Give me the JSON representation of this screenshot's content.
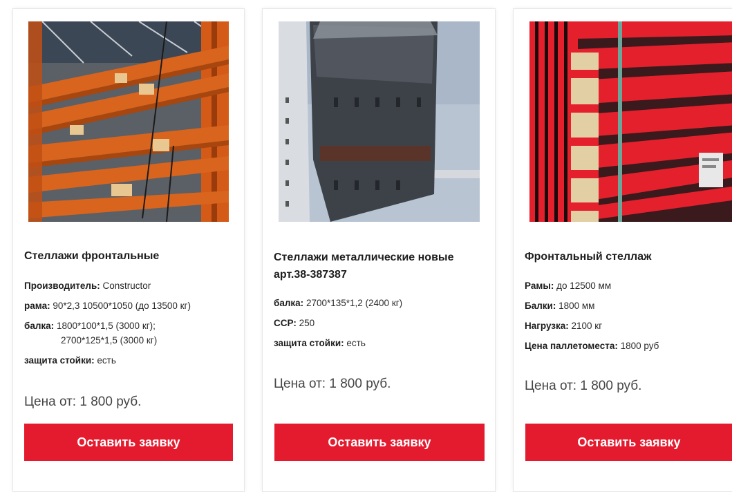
{
  "accent_color": "#e41b2e",
  "products": [
    {
      "image_icon": "orange-pallet-racks-photo",
      "title": "Стеллажи фронтальные",
      "specs": [
        {
          "label": "Производитель:",
          "value": "Constructor"
        },
        {
          "label": "рама:",
          "value": "90*2,3 10500*1050 (до 13500 кг)"
        },
        {
          "label": "балка:",
          "value": "1800*100*1,5 (3000 кг);",
          "value2": "2700*125*1,5 (3000 кг)"
        },
        {
          "label": "защита стойки:",
          "value": "есть"
        }
      ],
      "price": "Цена от: 1 800 руб.",
      "button": "Оставить заявку"
    },
    {
      "image_icon": "wrapped-metal-rack-photo",
      "title": "Стеллажи металлические новые арт.38-387387",
      "specs": [
        {
          "label": "балка:",
          "value": "2700*135*1,2 (2400 кг)"
        },
        {
          "label": "ССР:",
          "value": "250"
        },
        {
          "label": "защита стойки:",
          "value": "есть"
        }
      ],
      "price": "Цена от: 1 800 руб.",
      "button": "Оставить заявку"
    },
    {
      "image_icon": "red-rack-beams-photo",
      "title": "Фронтальный стеллаж",
      "specs": [
        {
          "label": "Рамы:",
          "value": "до 12500 мм"
        },
        {
          "label": "Балки:",
          "value": "1800 мм"
        },
        {
          "label": "Нагрузка:",
          "value": "2100 кг"
        },
        {
          "label": "Цена паллетоместа:",
          "value": "1800 руб"
        }
      ],
      "price": "Цена от: 1 800 руб.",
      "button": "Оставить заявку"
    }
  ]
}
